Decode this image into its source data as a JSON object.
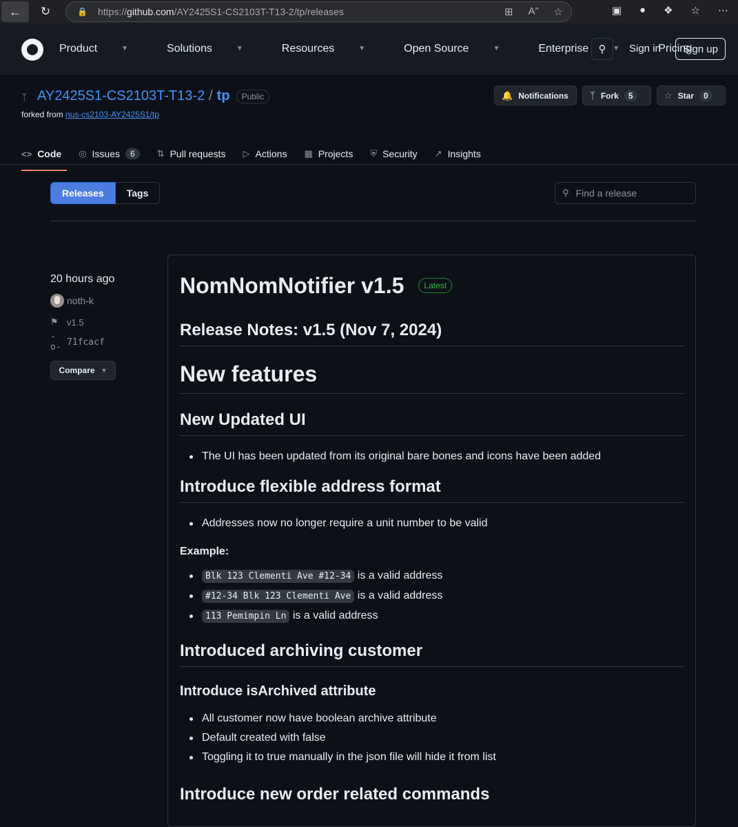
{
  "browser": {
    "url_prefix": "https://",
    "url_domain": "github.com",
    "url_path": "/AY2425S1-CS2103T-T13-2/tp/releases"
  },
  "header": {
    "nav": [
      "Product",
      "Solutions",
      "Resources",
      "Open Source",
      "Enterprise",
      "Pricing"
    ],
    "sign_in": "Sign in",
    "sign_up": "Sign up"
  },
  "repo": {
    "owner": "AY2425S1-CS2103T-T13-2",
    "separator": "/",
    "name": "tp",
    "visibility": "Public",
    "forked_prefix": "forked from ",
    "forked_from": "nus-cs2103-AY2425S1/tp",
    "notifications_label": "Notifications",
    "fork_label": "Fork",
    "fork_count": "5",
    "star_label": "Star",
    "star_count": "0"
  },
  "tabs": {
    "code": "Code",
    "issues": "Issues",
    "issues_count": "6",
    "pull_requests": "Pull requests",
    "actions": "Actions",
    "projects": "Projects",
    "security": "Security",
    "insights": "Insights"
  },
  "subnav": {
    "releases": "Releases",
    "tags": "Tags",
    "find_placeholder": "Find a release"
  },
  "release": {
    "time": "20 hours ago",
    "author": "noth-k",
    "tag": "v1.5",
    "commit": "71fcacf",
    "compare": "Compare",
    "title": "NomNomNotifier v1.5",
    "badge": "Latest",
    "notes_heading": "Release Notes: v1.5 (Nov 7, 2024)",
    "new_features": "New features",
    "ui_heading": "New Updated UI",
    "ui_item": "The UI has been updated from its original bare bones and icons have been added",
    "addr_heading": "Introduce flexible address format",
    "addr_item": "Addresses now no longer require a unit number to be valid",
    "example_label": "Example:",
    "examples": [
      {
        "code": "Blk 123 Clementi Ave #12-34",
        "text": " is a valid address"
      },
      {
        "code": "#12-34 Blk 123 Clementi Ave",
        "text": " is a valid address"
      },
      {
        "code": "113 Pemimpin Ln",
        "text": " is a valid address"
      }
    ],
    "archive_heading": "Introduced archiving customer",
    "isarchived_heading": "Introduce isArchived attribute",
    "archive_items": [
      "All customer now have boolean archive attribute",
      "Default created with false",
      "Toggling it to true manually in the json file will hide it from list"
    ],
    "order_heading": "Introduce new order related commands"
  }
}
